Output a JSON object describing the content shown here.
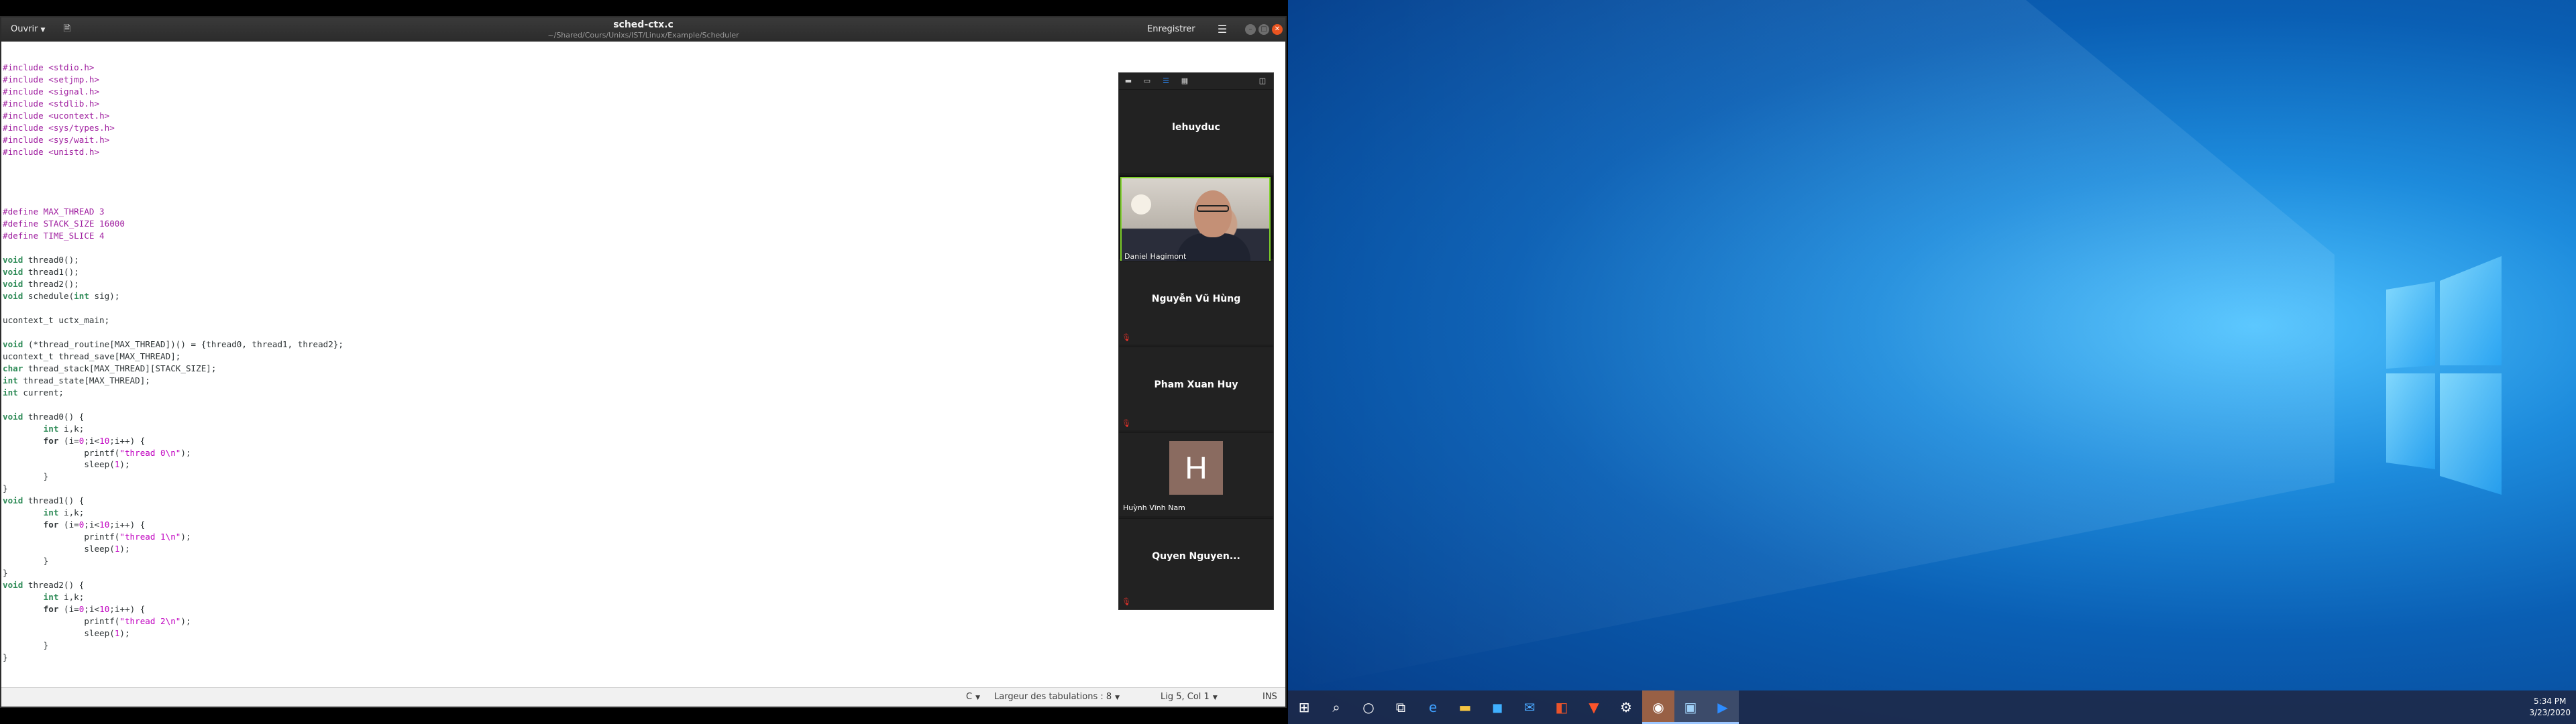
{
  "gedit": {
    "open_label": "Ouvrir",
    "title": "sched-ctx.c",
    "path": "~/Shared/Cours/Unixs/IST/Linux/Example/Scheduler",
    "save_label": "Enregistrer",
    "status": {
      "language": "C",
      "tab_width": "Largeur des tabulations : 8",
      "position": "Lig 5, Col 1",
      "insert_mode": "INS"
    }
  },
  "zoom": {
    "participants": [
      {
        "name": "lehuyduc",
        "video": false,
        "muted": false
      },
      {
        "name": "Daniel Hagimont",
        "video": true,
        "muted": false
      },
      {
        "name": "Nguyễn Vũ Hùng",
        "video": false,
        "muted": true
      },
      {
        "name": "Pham Xuan Huy",
        "video": false,
        "muted": true
      },
      {
        "name": "Huỳnh Vĩnh Nam",
        "video": false,
        "avatar_letter": "H",
        "muted": false
      },
      {
        "name": "Quyen  Nguyen...",
        "video": false,
        "muted": true
      }
    ]
  },
  "windows": {
    "clock_time": "5:34 PM",
    "clock_date": "3/23/2020"
  }
}
